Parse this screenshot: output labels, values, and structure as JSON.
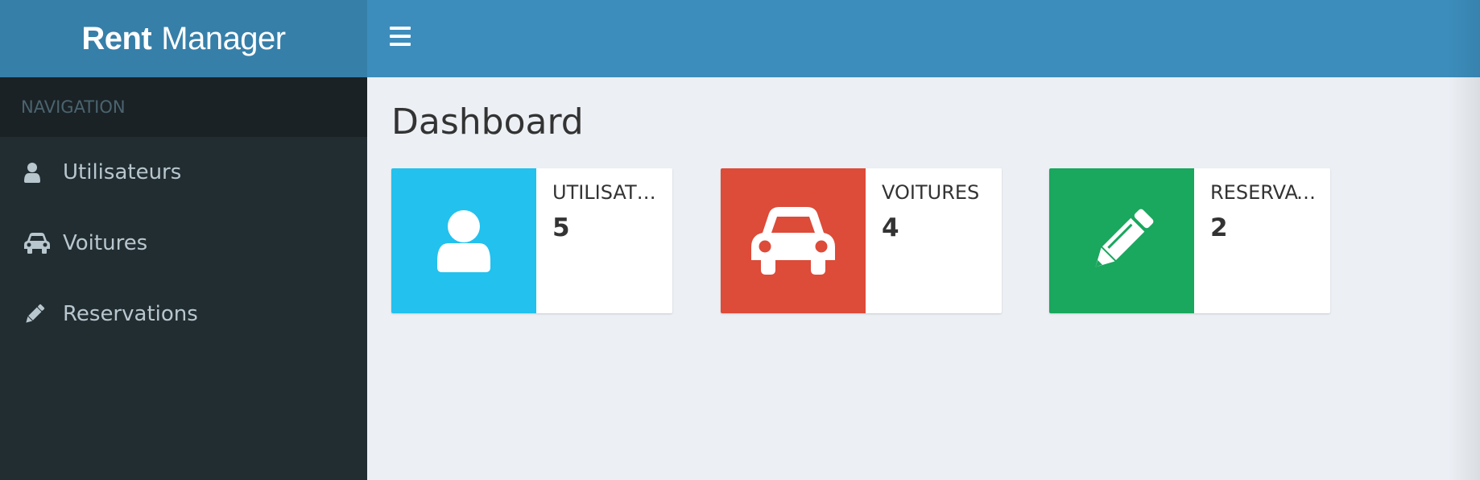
{
  "app": {
    "brand_strong": "Rent",
    "brand_light": "Manager"
  },
  "colors": {
    "logo_bg": "#367fa9",
    "navbar_bg": "#3c8dbc",
    "sidebar_bg": "#222d32",
    "aqua": "#00c0ef",
    "red": "#dd4b39",
    "green": "#00a65a"
  },
  "sidebar": {
    "header": "NAVIGATION",
    "items": [
      {
        "label": "Utilisateurs",
        "icon": "user-icon"
      },
      {
        "label": "Voitures",
        "icon": "car-icon"
      },
      {
        "label": "Reservations",
        "icon": "pencil-icon"
      }
    ]
  },
  "main": {
    "title": "Dashboard",
    "boxes": [
      {
        "label": "Utilisateurs",
        "value": "5",
        "icon": "user-icon",
        "color": "#22c1ee"
      },
      {
        "label": "Voitures",
        "value": "4",
        "icon": "car-icon",
        "color": "#dd4b39"
      },
      {
        "label": "Reservations",
        "value": "2",
        "icon": "pencil-icon",
        "color": "#1aa75e"
      }
    ]
  }
}
